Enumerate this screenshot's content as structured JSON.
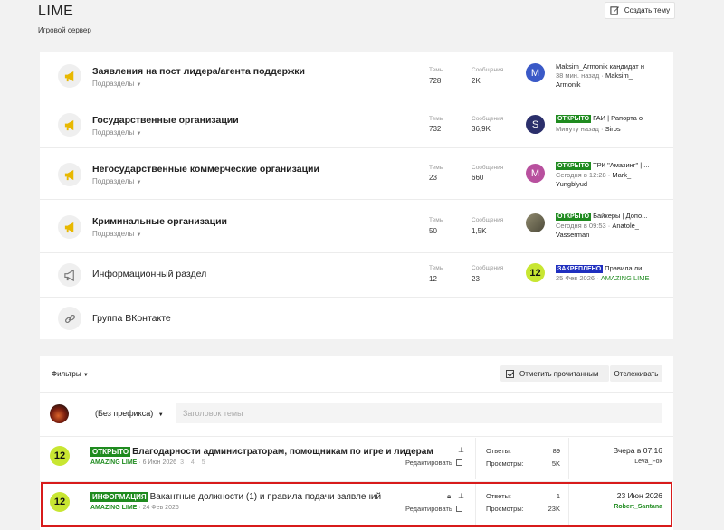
{
  "header": {
    "title": "LIME",
    "subtitle": "Игровой сервер",
    "create_label": "Создать тему"
  },
  "stat_labels": {
    "threads": "Темы",
    "messages": "Сообщения"
  },
  "sub_label": "Подразделы",
  "nodes": [
    {
      "name": "Заявления на пост лидера/агента поддержки",
      "has_sub": true,
      "threads": "728",
      "messages": "2K",
      "avatar_letter": "M",
      "avatar_color": "#3a59c7",
      "last_title": "Maksim_Armonik кандидат н",
      "last_time": "38 мин. назад",
      "last_user": "Maksim_ Armonik"
    },
    {
      "name": "Государственные организации",
      "has_sub": true,
      "threads": "732",
      "messages": "36,9K",
      "avatar_letter": "S",
      "avatar_color": "#2b2f6b",
      "last_prefix": "ОТКРЫТО",
      "last_title": "ГАИ | Рапорта о",
      "last_time": "Минуту назад",
      "last_user": "Siros"
    },
    {
      "name": "Негосударственные коммерческие организации",
      "has_sub": true,
      "threads": "23",
      "messages": "660",
      "avatar_letter": "M",
      "avatar_color": "#b8509e",
      "last_prefix": "ОТКРЫТО",
      "last_title": "ТРК \"Амазинг\" | ...",
      "last_time": "Сегодня в 12:28",
      "last_user": "Mark_ Yungblyud"
    },
    {
      "name": "Криминальные организации",
      "has_sub": true,
      "threads": "50",
      "messages": "1,5K",
      "avatar_letter": "",
      "avatar_color": "#6f6a55",
      "last_prefix": "ОТКРЫТО",
      "last_title": "Байкеры | Допо...",
      "last_time": "Сегодня в 09:53",
      "last_user": "Anatole_ Vasserman"
    },
    {
      "name": "Информационный раздел",
      "has_sub": false,
      "threads": "12",
      "messages": "23",
      "avatar_letter": "12",
      "avatar_color": "#c8e632",
      "last_prefix": "ЗАКРЕПЛЕНО",
      "last_title": "Правила ли...",
      "last_time": "25 Фев 2026",
      "last_user": "AMAZING LIME"
    },
    {
      "name": "Группа ВКонтакте",
      "has_sub": false
    }
  ],
  "threads_panel": {
    "filters_label": "Фильтры",
    "mark_read_label": "Отметить прочитанным",
    "follow_label": "Отслеживать",
    "prefix_select": "(Без префикса)",
    "title_placeholder": "Заголовок темы",
    "replies_label": "Ответы:",
    "views_label": "Просмотры:",
    "edit_label": "Редактировать"
  },
  "threads": [
    {
      "prefix": "ОТКРЫТО",
      "title": "Благодарности администраторам, помощникам по игре и лидерам",
      "author": "AMAZING LIME",
      "date": "6 Июн 2026",
      "pages": "3 4 5",
      "replies": "89",
      "views": "5K",
      "last_date": "Вчера в 07:16",
      "last_user": "Leva_Fox"
    },
    {
      "prefix": "ИНФОРМАЦИЯ",
      "title": "Вакантные должности (1) и правила подачи заявлений",
      "author": "AMAZING LIME",
      "date": "24 Фев 2026",
      "replies": "1",
      "views": "23K",
      "last_date": "23 Июн 2026",
      "last_user": "Robert_Santana"
    }
  ]
}
